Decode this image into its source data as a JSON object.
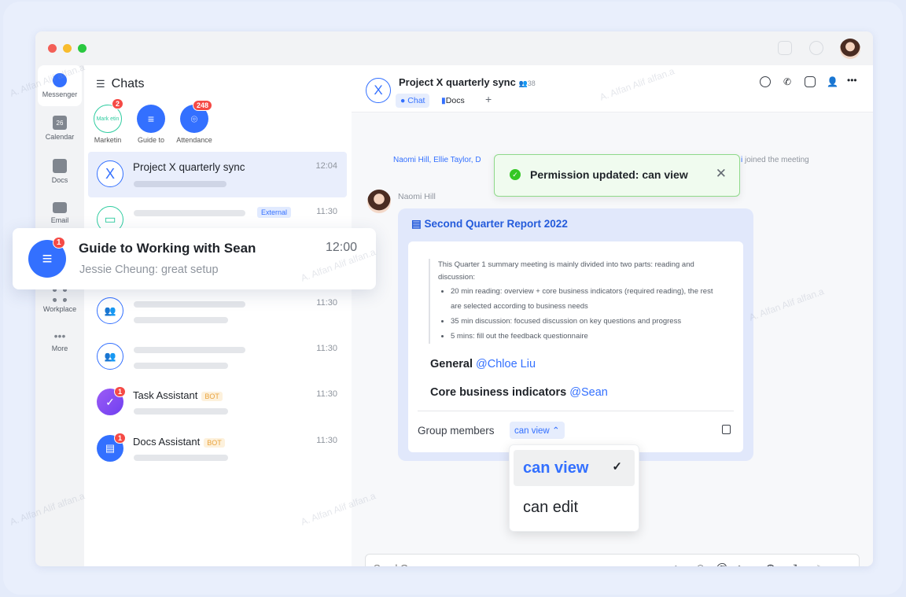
{
  "watermark": "A. Alfan Alif alfan.a",
  "rail": {
    "items": [
      {
        "label": "Messenger"
      },
      {
        "label": "Calendar",
        "day": "26"
      },
      {
        "label": "Docs"
      },
      {
        "label": "Email"
      },
      {
        "label": "Workplace"
      },
      {
        "label": "More"
      }
    ]
  },
  "chats": {
    "title": "Chats",
    "pinned": [
      {
        "label": "Marketin",
        "avatar_text": "Mark etin",
        "badge": "2"
      },
      {
        "label": "Guide to"
      },
      {
        "label": "Attendance",
        "badge": "248"
      }
    ],
    "rows": [
      {
        "title": "Project X quarterly sync",
        "avatar": "X",
        "time": "12:04"
      },
      {
        "tag": "External",
        "time": "11:30"
      },
      {
        "time": "11:30"
      },
      {
        "time": "11:30"
      },
      {
        "title": "Task Assistant",
        "tag": "BOT",
        "time": "11:30",
        "badge": "1"
      },
      {
        "title": "Docs Assistant",
        "tag": "BOT",
        "time": "11:30",
        "badge": "1"
      }
    ],
    "popup": {
      "title": "Guide to Working with Sean",
      "subtitle": "Jessie Cheung: great setup",
      "time": "12:00",
      "badge": "1"
    }
  },
  "header": {
    "avatar": "X",
    "title": "Project X quarterly sync",
    "member_count": "38",
    "tabs": [
      {
        "label": "Chat",
        "active": true
      },
      {
        "label": "Docs"
      }
    ],
    "add_tab": "+"
  },
  "feed": {
    "joined_names": [
      "Naomi Hill,",
      "Ellie Taylor,",
      "D",
      "i"
    ],
    "joined_text": "joined the meeting",
    "sender": "Naomi Hill",
    "card": {
      "title": "Second Quarter Report 2022",
      "intro": "This Quarter 1 summary meeting is mainly divided into two parts: reading and discussion:",
      "bullets": [
        "20 min reading: overview + core business indicators (required reading), the rest are selected according to business needs",
        "35 min discussion: focused discussion on key questions and progress",
        "5 mins: fill out the feedback questionnaire"
      ],
      "general_label": "General",
      "general_mention": "@Chloe Liu",
      "core_label": "Core business indicators",
      "core_mention": "@Sean",
      "members_label": "Group members",
      "permission": "can view"
    }
  },
  "dropdown": {
    "options": [
      {
        "label": "can view",
        "selected": true
      },
      {
        "label": "can edit"
      }
    ]
  },
  "toast": {
    "text": "Permission updated: can view"
  },
  "composer": {
    "placeholder": "Send Group"
  },
  "colors": {
    "accent": "#3370ff",
    "toast_border": "#8fd98a",
    "toast_bg": "#f0fbef",
    "badge": "#f54a45"
  }
}
